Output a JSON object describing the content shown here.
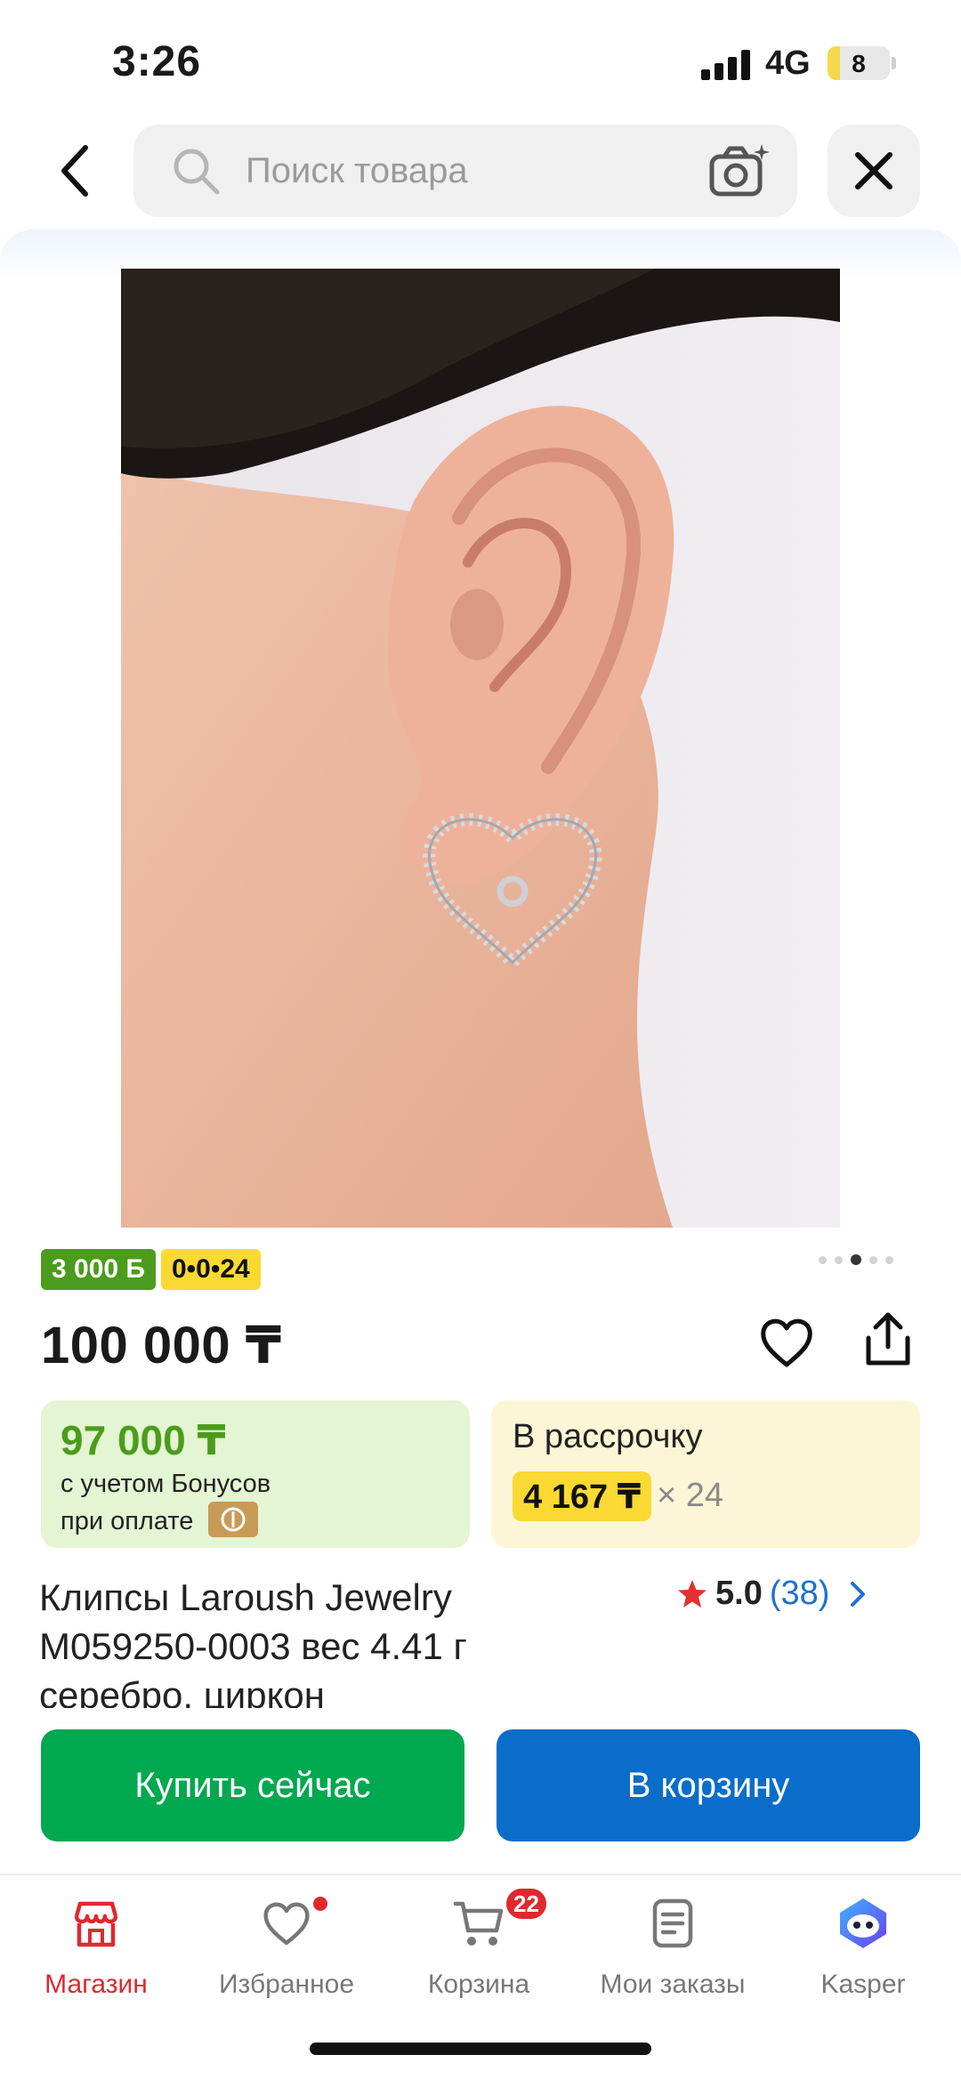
{
  "status_bar": {
    "time": "3:26",
    "network": "4G",
    "battery": "8"
  },
  "search": {
    "placeholder": "Поиск товара"
  },
  "gallery": {
    "dots_count": 5,
    "active_dot": 3
  },
  "badges": {
    "bonus": "3 000 Б",
    "installment": "0•0•24"
  },
  "product": {
    "price": "100 000 ₸",
    "title": "Клипсы Laroush Jewelry M059250-0003 вес 4.41 г серебро, циркон",
    "rating": "5.0",
    "reviews": "(38)"
  },
  "bonus_card": {
    "amount": "97 000 ₸",
    "line1": "с учетом Бонусов",
    "line2": "при оплате"
  },
  "installment_card": {
    "title": "В рассрочку",
    "monthly": "4 167 ₸",
    "times": "× 24"
  },
  "actions": {
    "buy_now": "Купить сейчас",
    "add_to_cart": "В корзину"
  },
  "bottom_nav": {
    "shop": "Магазин",
    "favorites": "Избранное",
    "cart": "Корзина",
    "cart_count": "22",
    "orders": "Мои заказы",
    "kasper": "Kasper"
  },
  "colors": {
    "accent_red": "#e0282e",
    "buy_green": "#00a84f",
    "cart_blue": "#0a6dc9",
    "bonus_green": "#4b9c1c",
    "installment_yellow": "#fad932"
  }
}
